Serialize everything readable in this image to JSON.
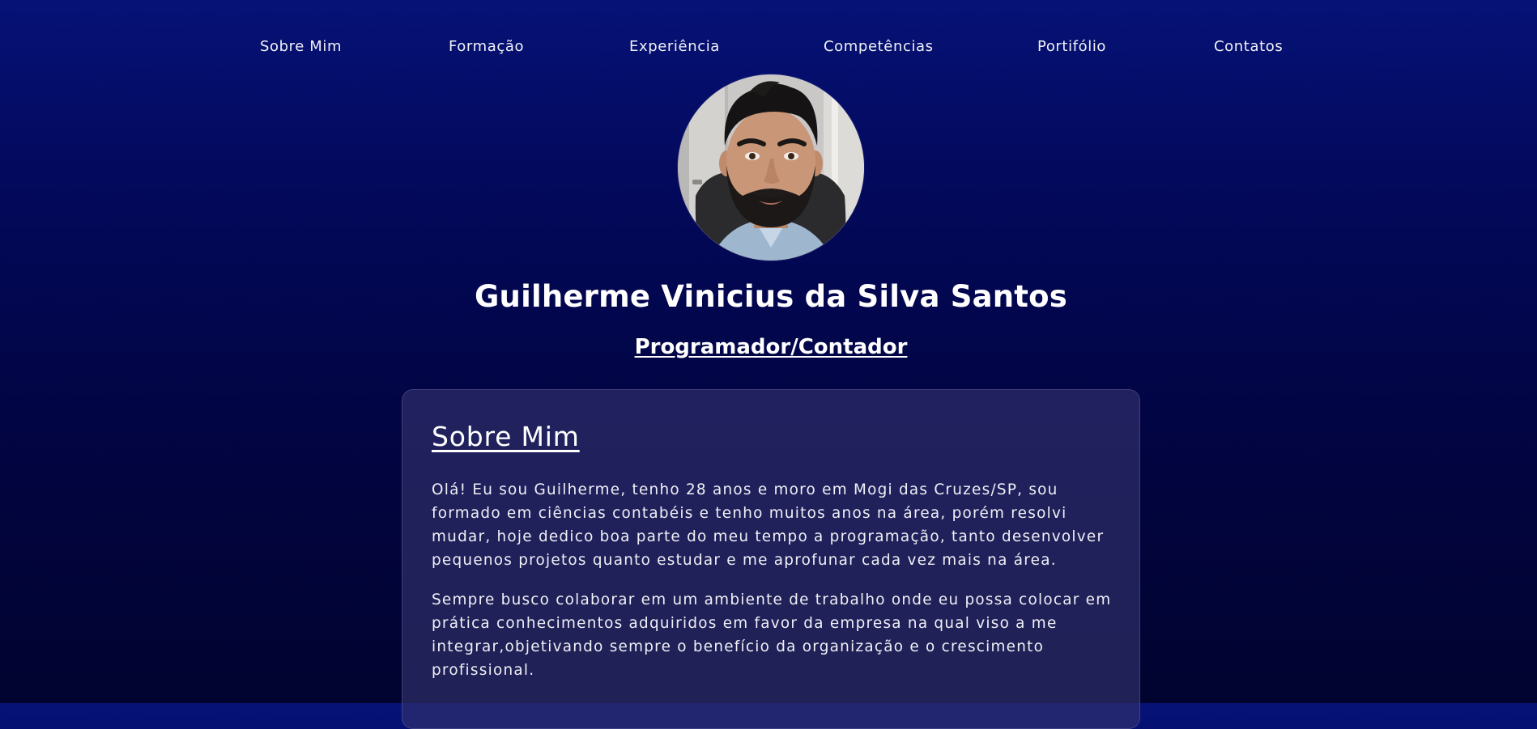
{
  "nav": {
    "items": [
      {
        "label": "Sobre Mim"
      },
      {
        "label": "Formação"
      },
      {
        "label": "Experiência"
      },
      {
        "label": "Competências"
      },
      {
        "label": "Portifólio"
      },
      {
        "label": "Contatos"
      }
    ]
  },
  "profile": {
    "name": "Guilherme Vinicius da Silva Santos",
    "role": "Programador/Contador"
  },
  "about": {
    "title": "Sobre Mim",
    "paragraphs": [
      "Olá! Eu sou Guilherme, tenho 28 anos e moro em Mogi das Cruzes/SP, sou formado em ciências contabéis e tenho muitos anos na área, porém resolvi mudar, hoje dedico boa parte do meu tempo a programação, tanto desenvolver pequenos projetos quanto estudar e me aprofunar cada vez mais na área.",
      "Sempre busco colaborar em um ambiente de trabalho onde eu possa colocar em prática conhecimentos adquiridos em favor da empresa na qual viso a me integrar,objetivando sempre o benefício da organização e o crescimento profissional."
    ]
  },
  "colors": {
    "background_top": "#061277",
    "background_bottom": "#01032f",
    "card_background": "#34346e",
    "text": "#ffffff"
  }
}
